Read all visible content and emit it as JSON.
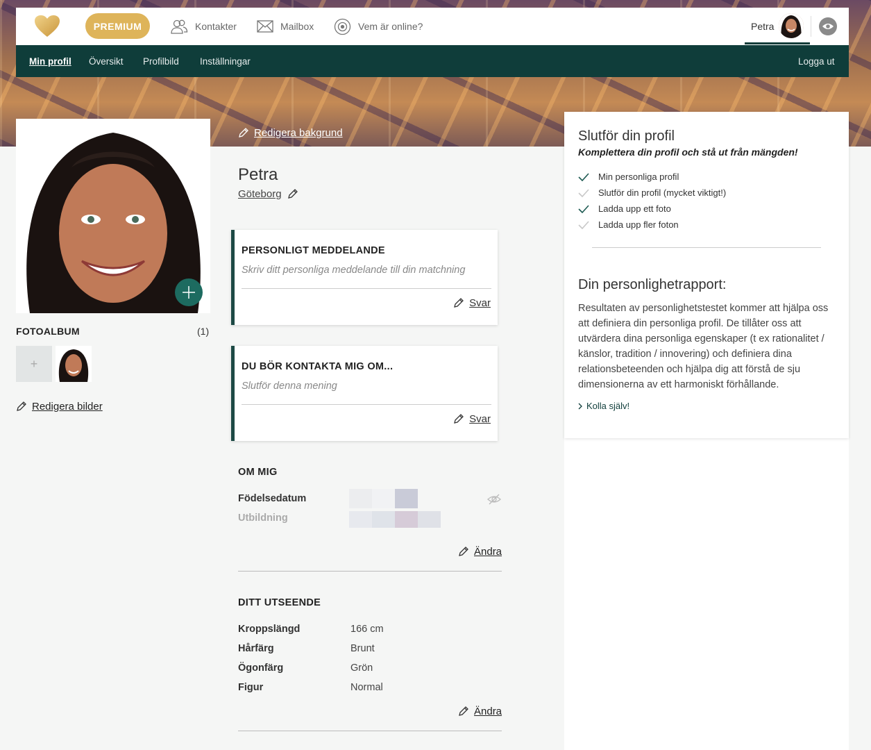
{
  "header": {
    "premium_label": "PREMIUM",
    "nav": [
      {
        "label": "Kontakter",
        "icon": "contacts-icon"
      },
      {
        "label": "Mailbox",
        "icon": "mail-icon"
      },
      {
        "label": "Vem är online?",
        "icon": "online-icon"
      }
    ],
    "user_name": "Petra"
  },
  "subnav": {
    "items": [
      "Min profil",
      "Översikt",
      "Profilbild",
      "Inställningar"
    ],
    "active": "Min profil",
    "logout": "Logga ut"
  },
  "left": {
    "album_title": "FOTOALBUM",
    "album_count": "(1)",
    "album_add": "+",
    "edit_images": "Redigera bilder"
  },
  "profile": {
    "edit_background": "Redigera bakgrund",
    "name": "Petra",
    "city": "Göteborg"
  },
  "cards": [
    {
      "title": "PERSONLIGT MEDDELANDE",
      "subtitle": "Skriv ditt personliga meddelande till din matchning",
      "action": "Svar"
    },
    {
      "title": "DU BÖR KONTAKTA MIG OM...",
      "subtitle": "Slutför denna mening",
      "action": "Svar"
    }
  ],
  "about": {
    "title": "OM MIG",
    "rows": [
      "Födelsedatum",
      "Utbildning"
    ],
    "edit": "Ändra"
  },
  "appearance": {
    "title": "DITT UTSEENDE",
    "rows": [
      {
        "label": "Kroppslängd",
        "value": "166 cm"
      },
      {
        "label": "Hårfärg",
        "value": "Brunt"
      },
      {
        "label": "Ögonfärg",
        "value": "Grön"
      },
      {
        "label": "Figur",
        "value": "Normal"
      }
    ],
    "edit": "Ändra"
  },
  "complete": {
    "title": "Slutför din profil",
    "subtitle": "Komplettera din profil och stå ut från mängden!",
    "items": [
      {
        "label": "Min personliga profil",
        "done": true
      },
      {
        "label": "Slutför din profil (mycket viktigt!)",
        "done": false
      },
      {
        "label": "Ladda upp ett foto",
        "done": true
      },
      {
        "label": "Ladda upp fler foton",
        "done": false
      }
    ]
  },
  "report": {
    "title": "Din personlighetrapport:",
    "text": "Resultaten av personlighetstestet kommer att hjälpa oss att definiera din personliga profil. De tillåter oss att utvärdera dina personliga egenskaper (t ex rationalitet / känslor, tradition / innovering) och definiera dina relationsbeteenden och hjälpa dig att förstå de sju dimensionerna av ett harmoniskt förhållande.",
    "link": "Kolla själv!"
  },
  "colors": {
    "brand_dark": "#0f3d3a",
    "accent_gold": "#deb45a",
    "teal_button": "#1d6b60"
  }
}
